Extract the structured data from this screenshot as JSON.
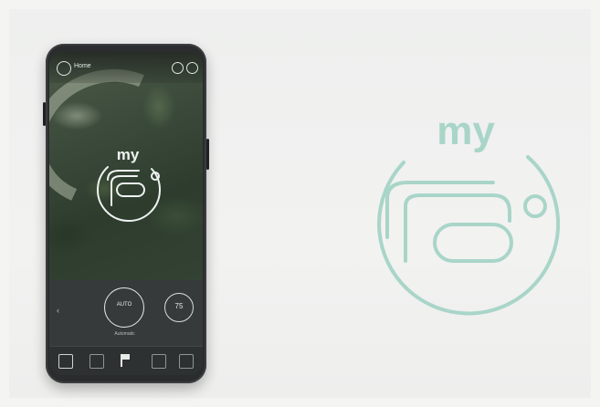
{
  "app": {
    "screen_title": "Home",
    "brand_logo_text": "my"
  },
  "colors": {
    "logo_teal": "#a9d5c9",
    "phone_logo_white": "#eef3f0",
    "phone_body": "#2a2c2d"
  },
  "controls": {
    "main_button_label": "AUTO",
    "main_caption": "Automatic",
    "secondary_value": "75"
  },
  "tabbar": {
    "icons": [
      "home-icon",
      "pump-icon",
      "flag-icon",
      "inbox-icon",
      "folder-icon"
    ]
  }
}
